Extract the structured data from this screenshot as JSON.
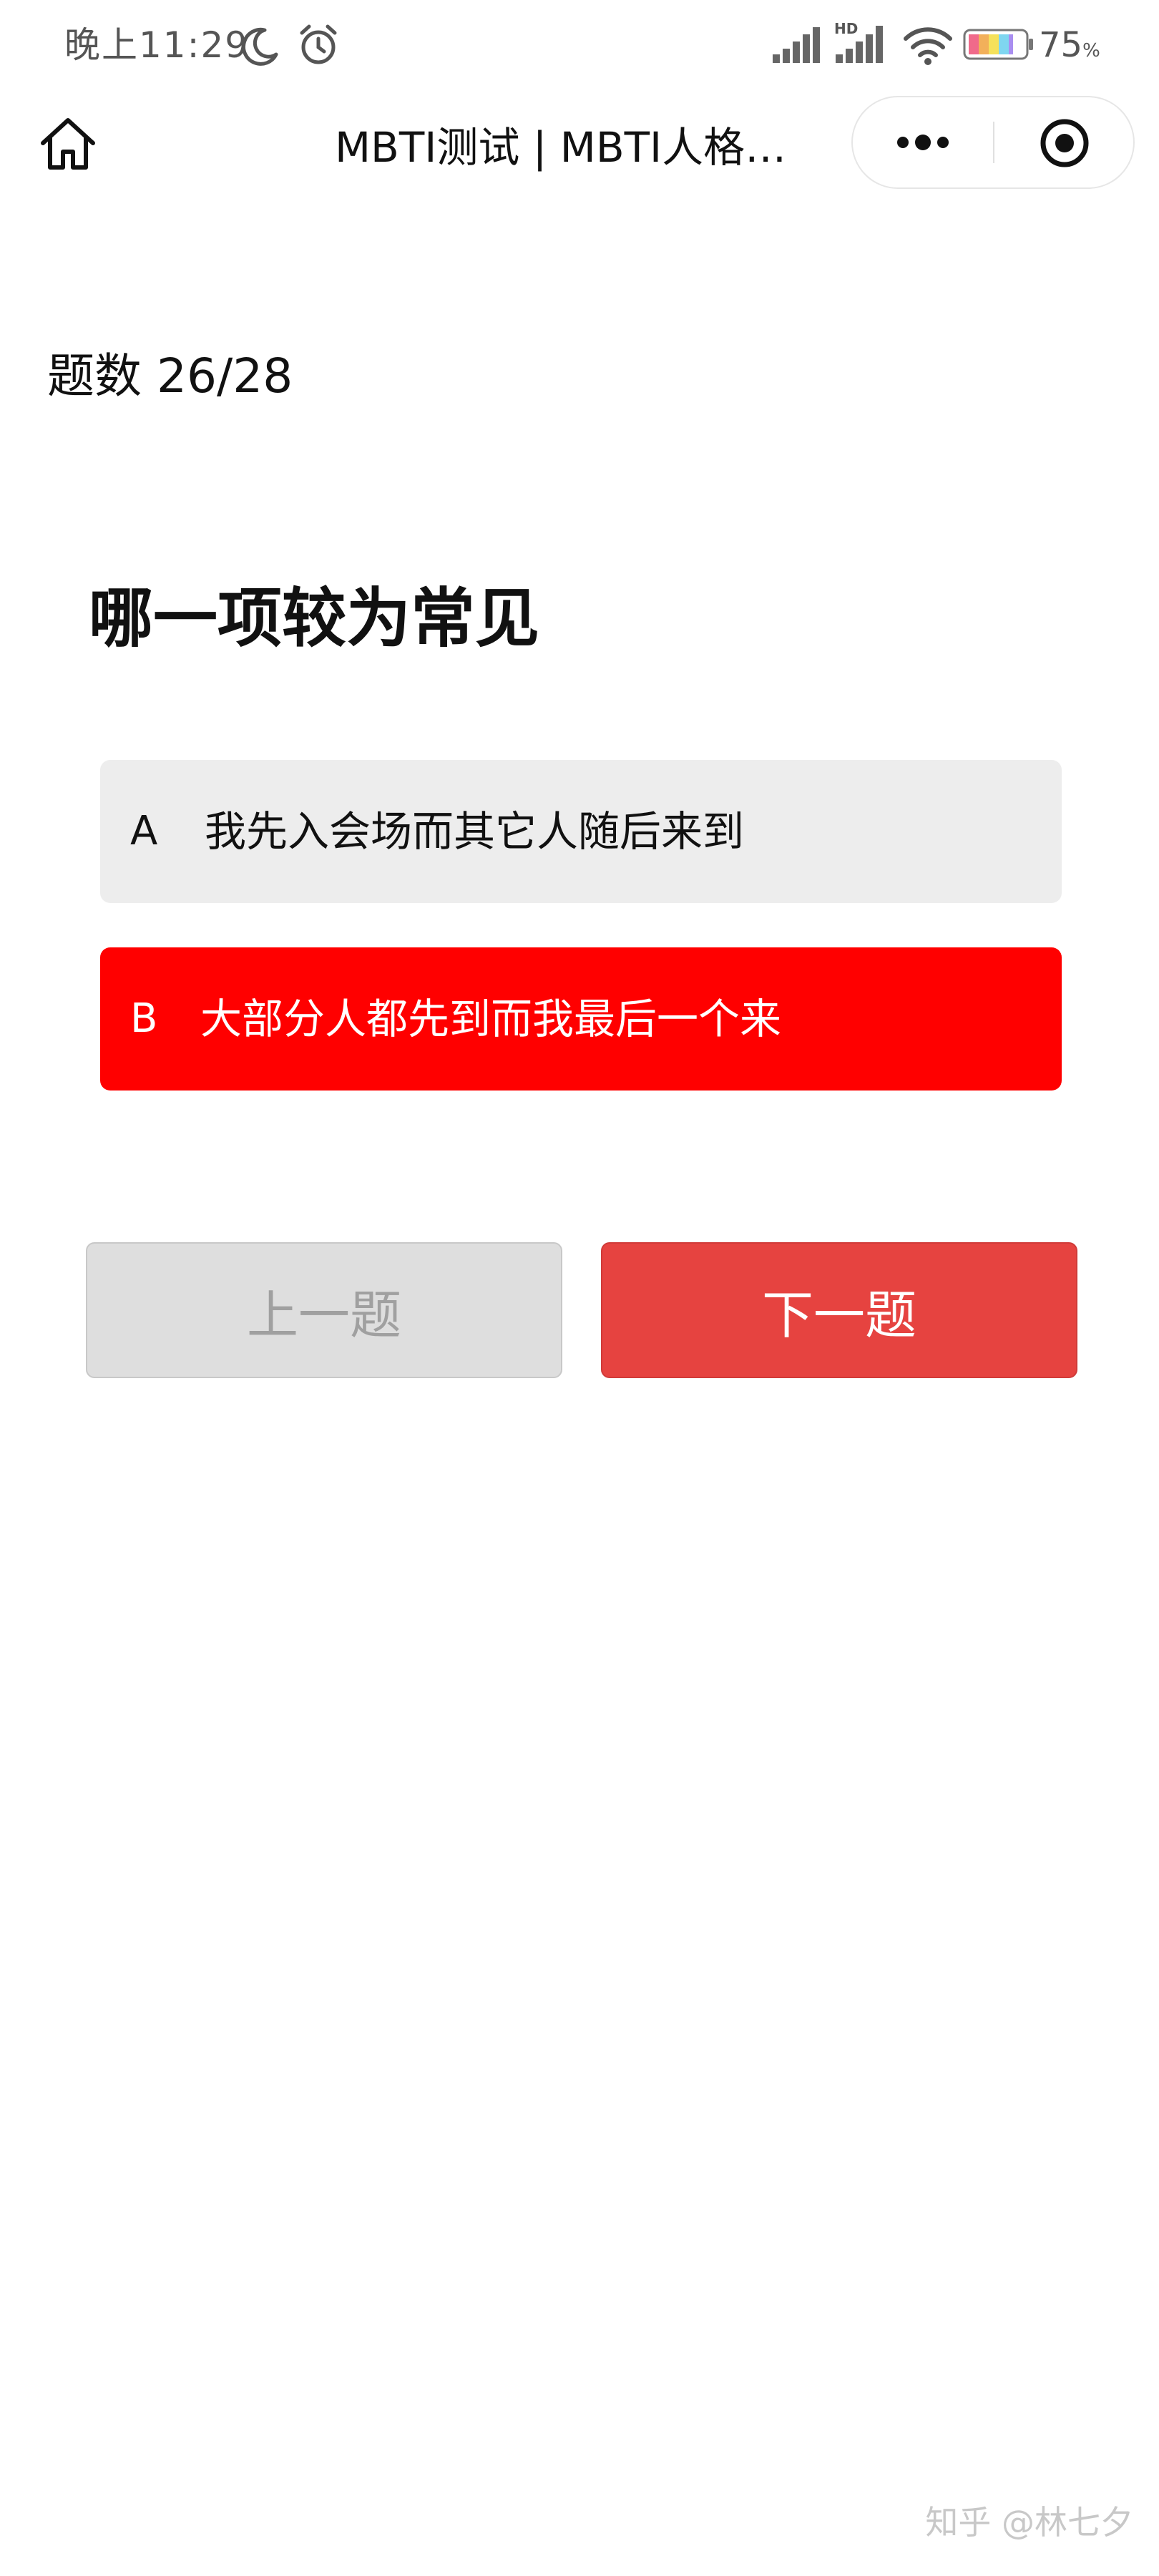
{
  "status_bar": {
    "time": "晚上11:29",
    "network_label": "HD",
    "battery": "75",
    "battery_unit": "%",
    "icons": [
      "moon-icon",
      "alarm-icon",
      "signal-icon",
      "hd-signal-icon",
      "wifi-icon",
      "battery-icon"
    ]
  },
  "nav": {
    "title": "MBTI测试 | MBTI人格…",
    "icons": [
      "home-icon",
      "more-icon",
      "close-target-icon"
    ]
  },
  "quiz": {
    "count_label": "题数 26/28",
    "question": "哪一项较为常见",
    "options": [
      {
        "letter": "A",
        "text": "我先入会场而其它人随后来到",
        "selected": false
      },
      {
        "letter": "B",
        "text": "大部分人都先到而我最后一个来",
        "selected": true
      }
    ],
    "prev_label": "上一题",
    "next_label": "下一题"
  },
  "watermark": "知乎 @林七夕",
  "colors": {
    "selected_option": "#ff0000",
    "unselected_option": "#ededed",
    "next_button": "#e64340",
    "prev_button": "#dedede"
  }
}
